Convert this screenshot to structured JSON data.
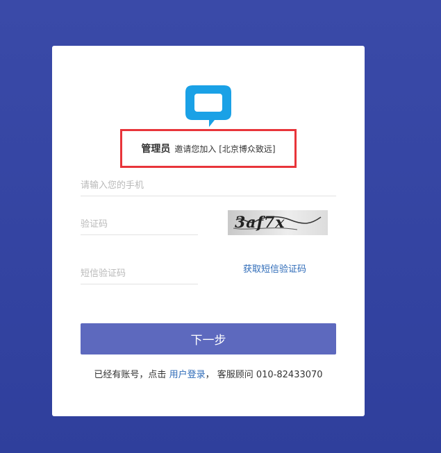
{
  "invite": {
    "role": "管理员",
    "text": "邀请您加入 [北京博众致远]"
  },
  "form": {
    "phone_placeholder": "请输入您的手机",
    "captcha_placeholder": "验证码",
    "captcha_image_text": "3af7x",
    "sms_placeholder": "短信验证码",
    "sms_link": "获取短信验证码",
    "next_label": "下一步"
  },
  "footer": {
    "prefix": "已经有账号，点击",
    "login_link": "用户登录",
    "separator": "，",
    "service_text": "客服顾问 010-82433070"
  },
  "colors": {
    "background": "#3a4aa8",
    "logo": "#1aa1e6",
    "highlight_border": "#e8343a",
    "button": "#5d69be",
    "link": "#2e6bb8"
  },
  "icons": {
    "logo": "chat-bubble-icon"
  }
}
